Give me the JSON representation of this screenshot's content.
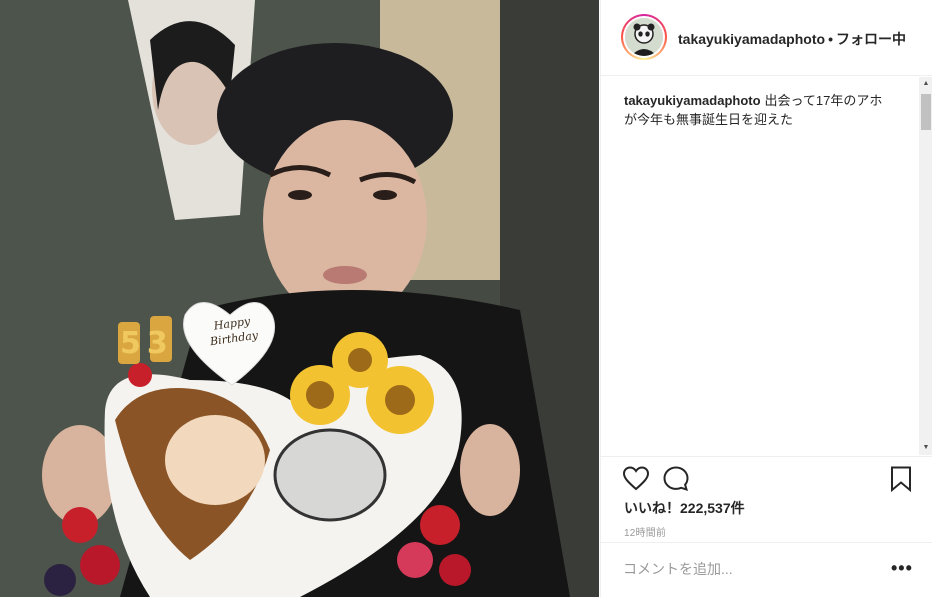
{
  "post": {
    "image_alt": "Woman in a black beret holding a heart-shaped birthday cake with a candle numbered 53",
    "cake_topper_text": "Happy Birthday",
    "candle_text": "53"
  },
  "header": {
    "username": "takayukiyamadaphoto",
    "separator": "•",
    "follow_label": "フォロー中"
  },
  "caption": {
    "username": "takayukiyamadaphoto",
    "text": "出会って17年のアホが今年も無事誕生日を迎えた"
  },
  "actions": {
    "like_icon": "heart-icon",
    "comment_icon": "speech-bubble-icon",
    "bookmark_icon": "bookmark-icon"
  },
  "likes": {
    "text": "いいね！222,537件"
  },
  "time": {
    "text": "12時間前"
  },
  "comment": {
    "placeholder": "コメントを追加...",
    "more_label": "•••"
  },
  "colors": {
    "text": "#262626",
    "muted": "#999999",
    "border": "#efefef",
    "story_ring": "#d6249f"
  }
}
